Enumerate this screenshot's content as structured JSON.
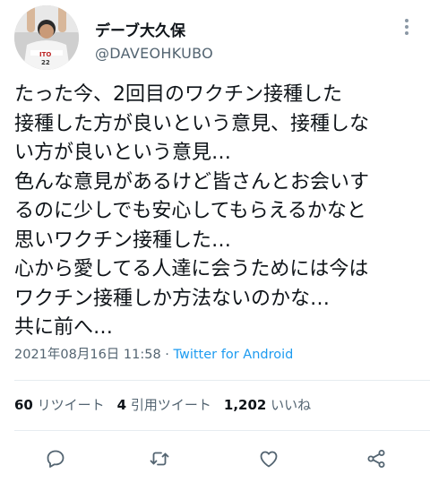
{
  "user": {
    "display_name": "デーブ大久保",
    "handle": "@DAVEOHKUBO"
  },
  "tweet": {
    "lines": [
      "たった今、2回目のワクチン接種した",
      "接種した方が良いという意見、接種しな",
      "い方が良いという意見…",
      "色んな意見があるけど皆さんとお会いす",
      "るのに少しでも安心してもらえるかなと",
      "思いワクチン接種した…",
      "心から愛してる人達に会うためには今は",
      "ワクチン接種しか方法ないのかな…",
      "共に前へ…"
    ],
    "timestamp": "2021年08月16日 11:58",
    "separator": " · ",
    "source": "Twitter for Android"
  },
  "stats": {
    "retweets_count": "60",
    "retweets_label": "リツイート",
    "quotes_count": "4",
    "quotes_label": "引用ツイート",
    "likes_count": "1,202",
    "likes_label": "いいね"
  },
  "icons": {
    "more": "more-icon",
    "reply": "reply-icon",
    "retweet": "retweet-icon",
    "like": "like-icon",
    "share": "share-icon"
  },
  "colors": {
    "text": "#0f1419",
    "secondary": "#536471",
    "link": "#1d9bf0",
    "divider": "#e6ecf0"
  }
}
